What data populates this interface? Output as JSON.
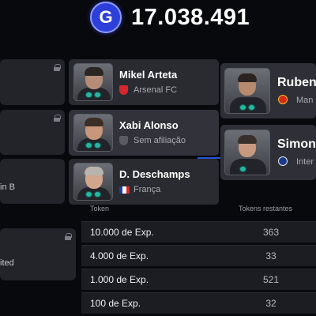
{
  "header": {
    "coin_symbol": "G",
    "coin_amount": "17.038.491",
    "coin_color": "#2c3fd9"
  },
  "left_cards": [
    {
      "text": "",
      "locked": true
    },
    {
      "text": "",
      "locked": true
    },
    {
      "text": "in B",
      "locked": false
    },
    {
      "text": "ited",
      "locked": true
    }
  ],
  "coaches": [
    {
      "name": "Mikel Arteta",
      "team": "Arsenal FC",
      "team_icon": "arsenal-crest-icon"
    },
    {
      "name": "Xabi Alonso",
      "team": "Sem afiliação",
      "team_icon": "no-affiliation-shield-icon"
    },
    {
      "name": "D. Deschamps",
      "team": "França",
      "team_icon": "france-flag-icon"
    }
  ],
  "right_coaches": [
    {
      "name": "Ruben",
      "team": "Man",
      "team_icon": "manchester-united-crest-icon"
    },
    {
      "name": "Simone",
      "team": "Inter",
      "team_icon": "inter-crest-icon"
    }
  ],
  "rewards_table": {
    "headers": {
      "token": "Token",
      "remaining": "Tokens restantes"
    },
    "rows": [
      {
        "label": "10.000 de Exp.",
        "remaining": "363"
      },
      {
        "label": "4.000 de Exp.",
        "remaining": "33"
      },
      {
        "label": "1.000 de Exp.",
        "remaining": "521"
      },
      {
        "label": "100 de Exp.",
        "remaining": "32"
      }
    ]
  }
}
